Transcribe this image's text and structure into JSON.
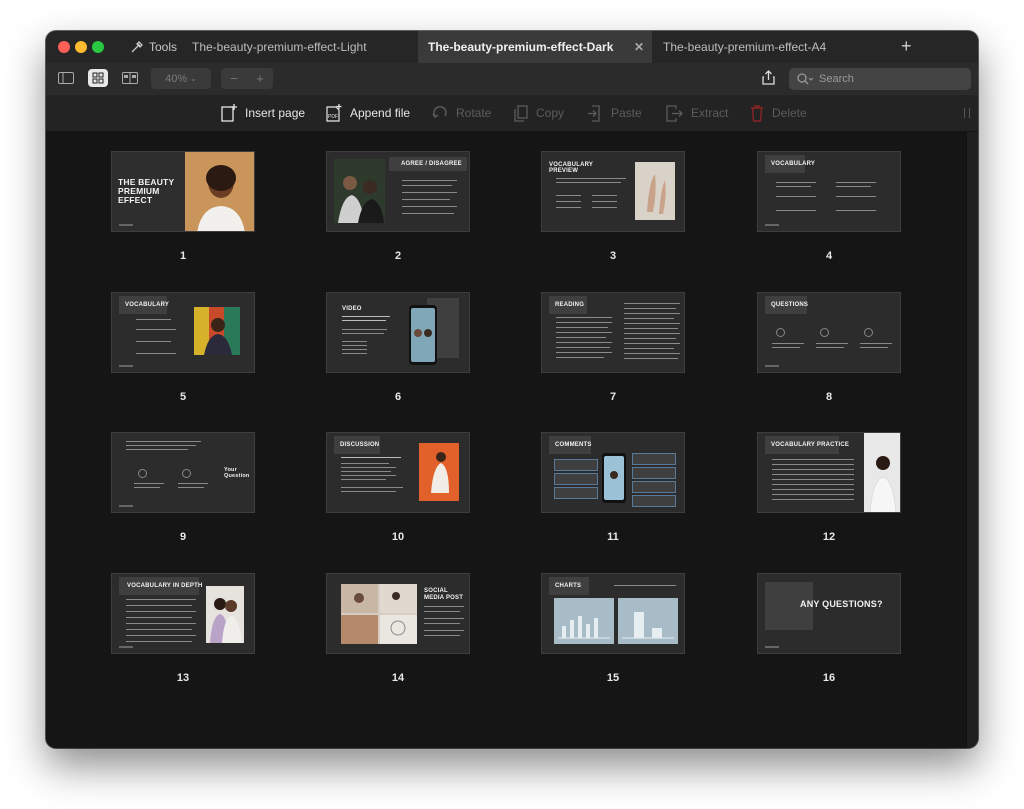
{
  "tabs": {
    "tools_label": "Tools",
    "items": [
      {
        "label": "The-beauty-premium-effect-Light"
      },
      {
        "label": "The-beauty-premium-effect-Dark"
      },
      {
        "label": "The-beauty-premium-effect-A4"
      }
    ]
  },
  "toolbar": {
    "zoom": "40%",
    "search_placeholder": "Search"
  },
  "actions": {
    "insert_page": "Insert page",
    "append_file": "Append file",
    "rotate": "Rotate",
    "copy": "Copy",
    "paste": "Paste",
    "extract": "Extract",
    "delete": "Delete"
  },
  "pages": [
    {
      "number": "1",
      "title": "THE BEAUTY PREMIUM EFFECT"
    },
    {
      "number": "2",
      "title": "AGREE / DISAGREE"
    },
    {
      "number": "3",
      "title": "VOCABULARY PREVIEW"
    },
    {
      "number": "4",
      "title": "VOCABULARY"
    },
    {
      "number": "5",
      "title": "VOCABULARY"
    },
    {
      "number": "6",
      "title": "VIDEO"
    },
    {
      "number": "7",
      "title": "READING"
    },
    {
      "number": "8",
      "title": "QUESTIONS"
    },
    {
      "number": "9",
      "title": "Your Question"
    },
    {
      "number": "10",
      "title": "DISCUSSION"
    },
    {
      "number": "11",
      "title": "COMMENTS"
    },
    {
      "number": "12",
      "title": "VOCABULARY PRACTICE"
    },
    {
      "number": "13",
      "title": "VOCABULARY IN DEPTH"
    },
    {
      "number": "14",
      "title": "SOCIAL MEDIA POST"
    },
    {
      "number": "15",
      "title": "CHARTS"
    },
    {
      "number": "16",
      "title": "ANY QUESTIONS?"
    }
  ],
  "colors": {
    "close": "#fe5f57",
    "minimize": "#febc2e",
    "zoom": "#28c840",
    "delete": "#b02a2a"
  }
}
